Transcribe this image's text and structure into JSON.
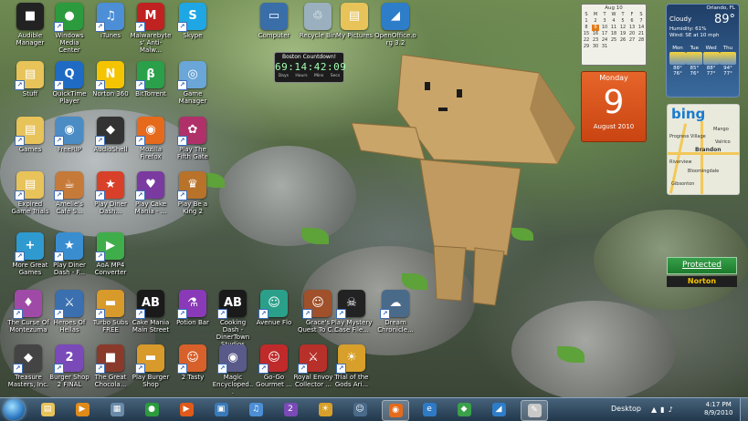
{
  "desktop_icons": [
    {
      "label": "Audible Manager",
      "color": "#222222",
      "glyph": "■"
    },
    {
      "label": "Windows Media Center",
      "color": "#2c9b3d",
      "glyph": "●"
    },
    {
      "label": "iTunes",
      "color": "#4d8fd6",
      "glyph": "♫"
    },
    {
      "label": "Malwarebytes' Anti-Malw...",
      "color": "#c02222",
      "glyph": "M"
    },
    {
      "label": "Skype",
      "color": "#1ea7e4",
      "glyph": "S"
    },
    {
      "label": "Computer",
      "color": "#3a6ea8",
      "glyph": "▭"
    },
    {
      "label": "Recycle Bin",
      "color": "#9ab0bf",
      "glyph": "♲"
    },
    {
      "label": "My Pictures",
      "color": "#e7c35a",
      "glyph": "▤"
    },
    {
      "label": "OpenOffice.org 3.2",
      "color": "#2e7dc8",
      "glyph": "◢"
    },
    {
      "label": "Stuff",
      "color": "#e7c35a",
      "glyph": "▤"
    },
    {
      "label": "QuickTime Player",
      "color": "#1f6bc4",
      "glyph": "Q"
    },
    {
      "label": "Norton 360",
      "color": "#f5c400",
      "glyph": "N"
    },
    {
      "label": "BitTorrent",
      "color": "#2aa04a",
      "glyph": "β"
    },
    {
      "label": "Game Manager",
      "color": "#6aa6d8",
      "glyph": "◎"
    },
    {
      "label": "Games",
      "color": "#e7c35a",
      "glyph": "▤"
    },
    {
      "label": "FreeRIP",
      "color": "#4b8cc4",
      "glyph": "◉"
    },
    {
      "label": "AudioShell",
      "color": "#333333",
      "glyph": "◆"
    },
    {
      "label": "Mozilla Firefox",
      "color": "#e56a1c",
      "glyph": "◉"
    },
    {
      "label": "Play The Fifth Gate",
      "color": "#b0306a",
      "glyph": "✿"
    },
    {
      "label": "Expired Game Trials",
      "color": "#e7c35a",
      "glyph": "▤"
    },
    {
      "label": "Amelie's Café S...",
      "color": "#c67a3a",
      "glyph": "☕"
    },
    {
      "label": "Play Diner Dash...",
      "color": "#d8402a",
      "glyph": "★"
    },
    {
      "label": "Play Cake Mania - ...",
      "color": "#7a3aa0",
      "glyph": "♥"
    },
    {
      "label": "Play Be a King 2",
      "color": "#b8722a",
      "glyph": "♛"
    },
    {
      "label": "More Great Games",
      "color": "#2f9ad0",
      "glyph": "+"
    },
    {
      "label": "Play Diner Dash - F...",
      "color": "#3a8ed0",
      "glyph": "★"
    },
    {
      "label": "AoA MP4 Converter",
      "color": "#3fae4a",
      "glyph": "▶"
    },
    {
      "label": "The Curse Of Montezuma",
      "color": "#a04aa8",
      "glyph": "♦"
    },
    {
      "label": "Heroes Of Hellas",
      "color": "#3a6fb0",
      "glyph": "⚔"
    },
    {
      "label": "Turbo Subs FREE",
      "color": "#d89a2a",
      "glyph": "▬"
    },
    {
      "label": "Cake Mania Main Street",
      "color": "#1a1a1a",
      "glyph": "AB"
    },
    {
      "label": "Potion Bar",
      "color": "#8a3ab8",
      "glyph": "⚗"
    },
    {
      "label": "Cooking Dash - DinerTown Studios",
      "color": "#1a1a1a",
      "glyph": "AB"
    },
    {
      "label": "Avenue Flo",
      "color": "#2aa08a",
      "glyph": "☺"
    },
    {
      "label": "Grace's Quest To C...",
      "color": "#a0502a",
      "glyph": "☺"
    },
    {
      "label": "Play Mystery Case File...",
      "color": "#222222",
      "glyph": "☠"
    },
    {
      "label": "Dream Chronicle...",
      "color": "#4a6a8a",
      "glyph": "☁"
    },
    {
      "label": "Treasure Masters, Inc.",
      "color": "#444444",
      "glyph": "◆"
    },
    {
      "label": "Burger Shop 2 FINAL",
      "color": "#7a4ab8",
      "glyph": "2"
    },
    {
      "label": "The Great Chocola...",
      "color": "#8a3a2a",
      "glyph": "■"
    },
    {
      "label": "Play Burger Shop",
      "color": "#d89a2a",
      "glyph": "▬"
    },
    {
      "label": "2 Tasty",
      "color": "#d8602a",
      "glyph": "☺"
    },
    {
      "label": "Magic Encycloped...",
      "color": "#5a5a8a",
      "glyph": "◉"
    },
    {
      "label": "Go-Go Gourmet ...",
      "color": "#c02a2a",
      "glyph": "☺"
    },
    {
      "label": "Royal Envoy Collector ...",
      "color": "#b8302a",
      "glyph": "⚔"
    },
    {
      "label": "Trial of the Gods Ari...",
      "color": "#d8a02a",
      "glyph": "☀"
    }
  ],
  "countdown": {
    "title": "Boston Countdown!",
    "value": "69:14:42:09",
    "units": [
      "Days",
      "Hours",
      "Mins",
      "Secs"
    ]
  },
  "calendar": {
    "month_title": "Aug 10",
    "weekdays": [
      "S",
      "M",
      "T",
      "W",
      "T",
      "F",
      "S"
    ],
    "weeks": [
      [
        "1",
        "2",
        "3",
        "4",
        "5",
        "6",
        "7"
      ],
      [
        "8",
        "9",
        "10",
        "11",
        "12",
        "13",
        "14"
      ],
      [
        "15",
        "16",
        "17",
        "18",
        "19",
        "20",
        "21"
      ],
      [
        "22",
        "23",
        "24",
        "25",
        "26",
        "27",
        "28"
      ],
      [
        "29",
        "30",
        "31",
        "",
        "",
        "",
        ""
      ]
    ],
    "today": "9",
    "day_name": "Monday",
    "day_number": "9",
    "month_year": "August 2010"
  },
  "weather": {
    "city": "Orlando, FL",
    "condition": "Cloudy",
    "temperature": "89°",
    "humidity": "Humidity: 61%",
    "wind": "Wind: SE at 10 mph",
    "forecast": [
      {
        "day": "Mon",
        "high": "88°",
        "low": "76°"
      },
      {
        "day": "Tue",
        "high": "85°",
        "low": "76°"
      },
      {
        "day": "Wed",
        "high": "88°",
        "low": "77°"
      },
      {
        "day": "Thu",
        "high": "94°",
        "low": "77°"
      }
    ]
  },
  "bing_map": {
    "logo": "bing",
    "places": [
      "Brandon",
      "Mango",
      "Riverview",
      "Valrico",
      "Bloomingdale",
      "Progress Village",
      "Gibsonton"
    ]
  },
  "norton_widget": {
    "status": "Protected",
    "brand": "Norton"
  },
  "taskbar": {
    "apps": [
      {
        "name": "explorer",
        "color": "#e7c35a",
        "glyph": "▤"
      },
      {
        "name": "windows-media-player",
        "color": "#e08a1a",
        "glyph": "▶"
      },
      {
        "name": "calculator",
        "color": "#6a8aa8",
        "glyph": "▦"
      },
      {
        "name": "media-center",
        "color": "#2c9b3d",
        "glyph": "●"
      },
      {
        "name": "media-player-2",
        "color": "#e05a1a",
        "glyph": "▶"
      },
      {
        "name": "network",
        "color": "#3a7ab8",
        "glyph": "▣"
      },
      {
        "name": "itunes",
        "color": "#4d8fd6",
        "glyph": "♫"
      },
      {
        "name": "burger-shop-2",
        "color": "#7a4ab8",
        "glyph": "2"
      },
      {
        "name": "game-2",
        "color": "#d8a02a",
        "glyph": "☀"
      },
      {
        "name": "game-3",
        "color": "#4a6a8a",
        "glyph": "☺"
      },
      {
        "name": "firefox",
        "color": "#e56a1c",
        "glyph": "◉"
      },
      {
        "name": "internet-explorer",
        "color": "#2f7ac4",
        "glyph": "e"
      },
      {
        "name": "windows-live",
        "color": "#3aa04a",
        "glyph": "◆"
      },
      {
        "name": "openoffice",
        "color": "#2e7dc8",
        "glyph": "◢"
      },
      {
        "name": "paint",
        "color": "#c8c8c8",
        "glyph": "✎"
      }
    ],
    "desktop_label": "Desktop",
    "time": "4:17 PM",
    "date": "8/9/2010"
  }
}
